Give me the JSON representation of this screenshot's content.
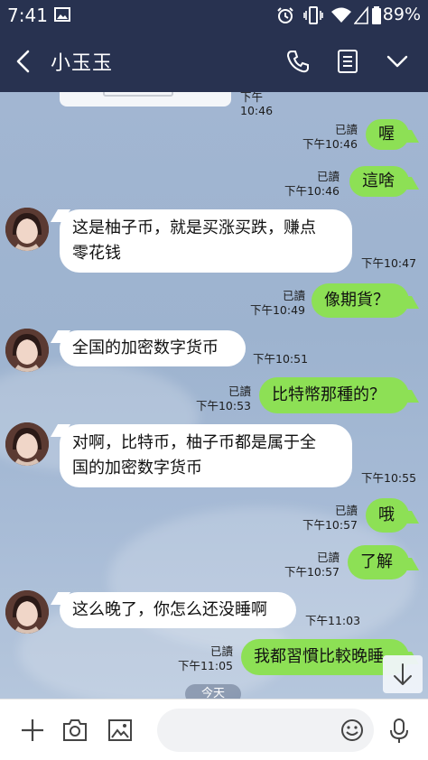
{
  "status": {
    "time": "7:41",
    "battery": "89%"
  },
  "header": {
    "title": "小玉玉"
  },
  "top_partial": {
    "time": "下午10:46"
  },
  "messages": [
    {
      "dir": "out",
      "text": "喔",
      "read": "已讀",
      "time": "下午10:46"
    },
    {
      "dir": "out",
      "text": "這啥",
      "read": "已讀",
      "time": "下午10:46"
    },
    {
      "dir": "in",
      "lines": [
        "这是柚子币，就是买涨买跌，赚点",
        "零花钱"
      ],
      "time": "下午10:47"
    },
    {
      "dir": "out",
      "text": "像期貨？",
      "read": "已讀",
      "time": "下午10:49"
    },
    {
      "dir": "in",
      "lines": [
        "全国的加密数字货币"
      ],
      "time": "下午10:51"
    },
    {
      "dir": "out",
      "text": "比特幣那種的？",
      "read": "已讀",
      "time": "下午10:53"
    },
    {
      "dir": "in",
      "lines": [
        "对啊，比特币，柚子币都是属于全",
        "国的加密数字货币"
      ],
      "time": "下午10:55"
    },
    {
      "dir": "out",
      "text": "哦",
      "read": "已讀",
      "time": "下午10:57"
    },
    {
      "dir": "out",
      "text": "了解",
      "read": "已讀",
      "time": "下午10:57"
    },
    {
      "dir": "in",
      "lines": [
        "这么晚了，你怎么还没睡啊"
      ],
      "time": "下午11:03"
    },
    {
      "dir": "out",
      "text": "我都習慣比較晚睡",
      "read": "已讀",
      "time": "下午11:05"
    }
  ],
  "date_chip": "今天",
  "icons": {
    "status": [
      "image-icon",
      "alarm-icon",
      "vibrate-icon",
      "wifi-icon",
      "signal-icon",
      "battery-icon"
    ],
    "header": [
      "back-icon",
      "phone-icon",
      "notes-icon",
      "chevron-down-icon"
    ],
    "bottom": [
      "plus-icon",
      "camera-icon",
      "gallery-icon",
      "emoji-icon",
      "mic-icon"
    ],
    "scroll": "arrow-down-icon"
  },
  "colors": {
    "header_bg": "#283250",
    "out_bubble": "#8de055",
    "in_bubble": "#ffffff"
  }
}
